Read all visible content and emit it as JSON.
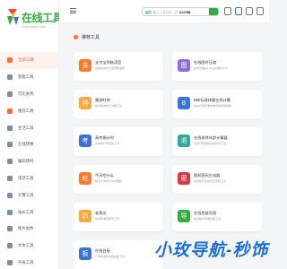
{
  "logo": {
    "text": "在线工具",
    "sub": "TOOL TOOLS.COM"
  },
  "sidebar": {
    "items": [
      {
        "label": "全部工具",
        "color": "#ff6a3c",
        "active": true
      },
      {
        "label": "智能工具",
        "color": "#7a8ea8"
      },
      {
        "label": "可比查找",
        "color": "#7a8ea8"
      },
      {
        "label": "推荐工具",
        "color": "#ff6a3c"
      },
      {
        "label": "生活工具",
        "color": "#7a8ea8"
      },
      {
        "label": "在线转换",
        "color": "#7a8ea8"
      },
      {
        "label": "编码转码",
        "color": "#7a8ea8"
      },
      {
        "label": "电话工具",
        "color": "#7a8ea8"
      },
      {
        "label": "计算工具",
        "color": "#7a8ea8"
      },
      {
        "label": "站长工具",
        "color": "#7a8ea8"
      },
      {
        "label": "图片类色",
        "color": "#7a8ea8"
      },
      {
        "label": "文本工具",
        "color": "#7a8ea8"
      },
      {
        "label": "开发工具",
        "color": "#7a8ea8"
      }
    ]
  },
  "header": {
    "search_option": "站内",
    "search_hint": "输入工具名称，如",
    "search_strong": "ASCII码"
  },
  "section": {
    "title": "推荐工具"
  },
  "cards": [
    {
      "title": "支付宝到账语音",
      "desc": "在线生成支付宝到账语音",
      "color": "#ff7a2c",
      "glyph": "支"
    },
    {
      "title": "在线图片压缩",
      "desc": "在线压缩jpg,png,gif图片大小",
      "color": "#8b6fd6",
      "glyph": "图"
    },
    {
      "title": "墨迹时钟",
      "desc": "在线墨迹电子时钟工具",
      "color": "#ffa63c",
      "glyph": "钟"
    },
    {
      "title": "BMI标准体重在线计算",
      "desc": "在线计算标准体重身体质量指数",
      "color": "#3a72d8",
      "glyph": "B"
    },
    {
      "title": "高考倒计时",
      "desc": "高考倒计时在线工具",
      "color": "#3a72d8",
      "glyph": "考"
    },
    {
      "title": "在线退休年龄计算器",
      "desc": "在线计算退休年龄时间工具",
      "color": "#2fa8a0",
      "glyph": "退"
    },
    {
      "title": "今天吃什么",
      "desc": "解决今天吃什么的难题",
      "color": "#ff7a2c",
      "glyph": "吃"
    },
    {
      "title": "随机密码生成器",
      "desc": "在线随机生成安全密码工具",
      "color": "#d83a4a",
      "glyph": "密"
    },
    {
      "title": "老黄历",
      "desc": "在线查询老黄历工具",
      "color": "#ffa63c",
      "glyph": "历"
    },
    {
      "title": "在线思维导图",
      "desc": "在线制作思维导图工具",
      "color": "#2fae3c",
      "glyph": "导"
    },
    {
      "title": "在线白板",
      "desc": "一款简洁的在线白板工具",
      "color": "#3a72d8",
      "glyph": "板"
    }
  ],
  "watermark": "小玫导航-秒饰"
}
